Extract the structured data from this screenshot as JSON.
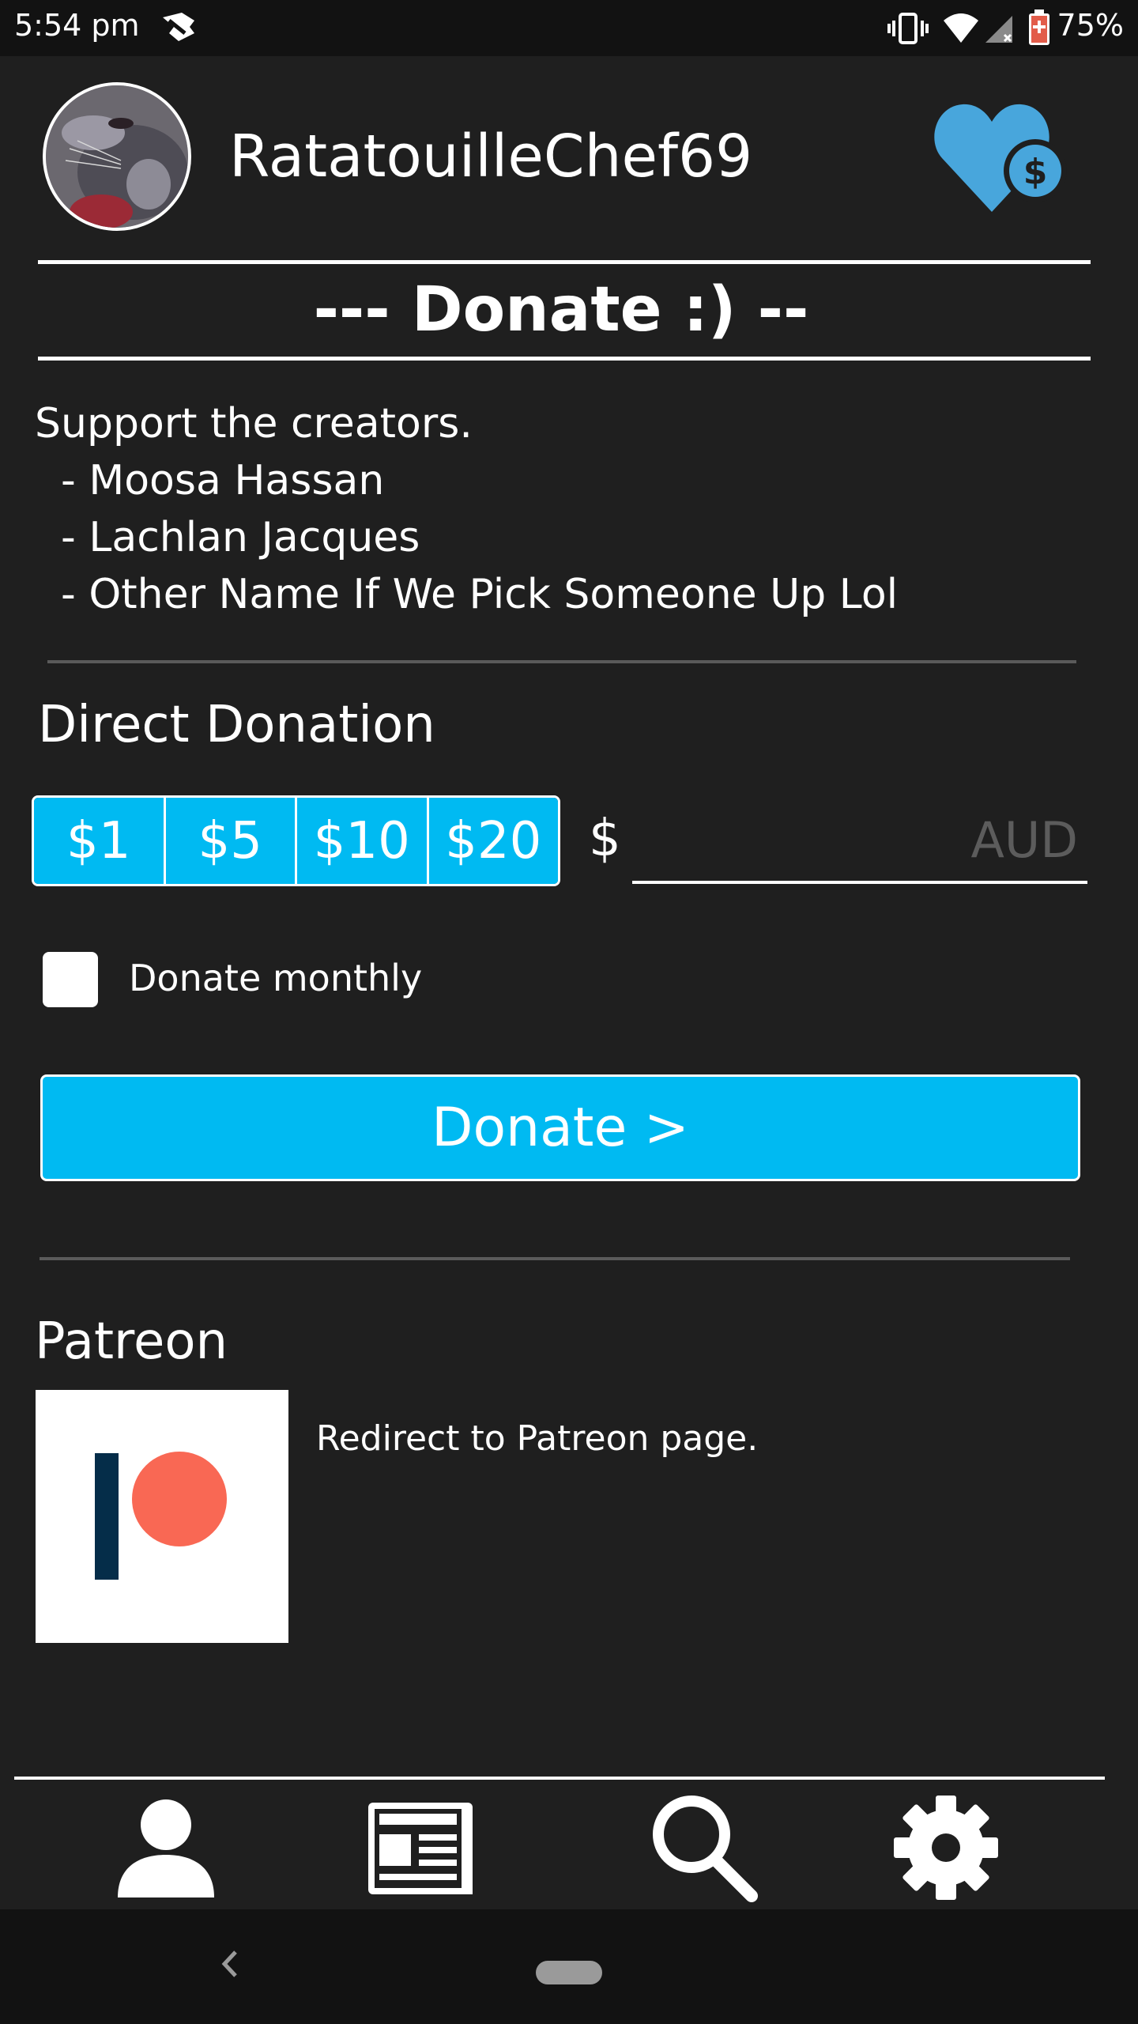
{
  "status_bar": {
    "time": "5:54 pm",
    "battery": "75%"
  },
  "header": {
    "username": "RatatouilleChef69"
  },
  "page": {
    "title": "--- Donate :) --"
  },
  "support": {
    "intro": "Support the creators.",
    "creators": [
      "  - Moosa Hassan",
      "  - Lachlan Jacques",
      "  - Other Name If We Pick Someone Up Lol"
    ]
  },
  "direct_donation": {
    "heading": "Direct Donation",
    "amounts": [
      "$1",
      "$5",
      "$10",
      "$20"
    ],
    "currency_symbol": "$",
    "custom_amount_placeholder": "AUD",
    "monthly_label": "Donate monthly",
    "donate_button": "Donate >"
  },
  "patreon": {
    "heading": "Patreon",
    "description": "Redirect to Patreon page."
  },
  "bottom_nav": {
    "items": [
      "profile-icon",
      "news-icon",
      "search-icon",
      "settings-icon"
    ]
  },
  "colors": {
    "background": "#1f1f1f",
    "accent": "#00baf2",
    "heart": "#48a6dc",
    "patreon_coral": "#f96854",
    "patreon_navy": "#052d49"
  }
}
